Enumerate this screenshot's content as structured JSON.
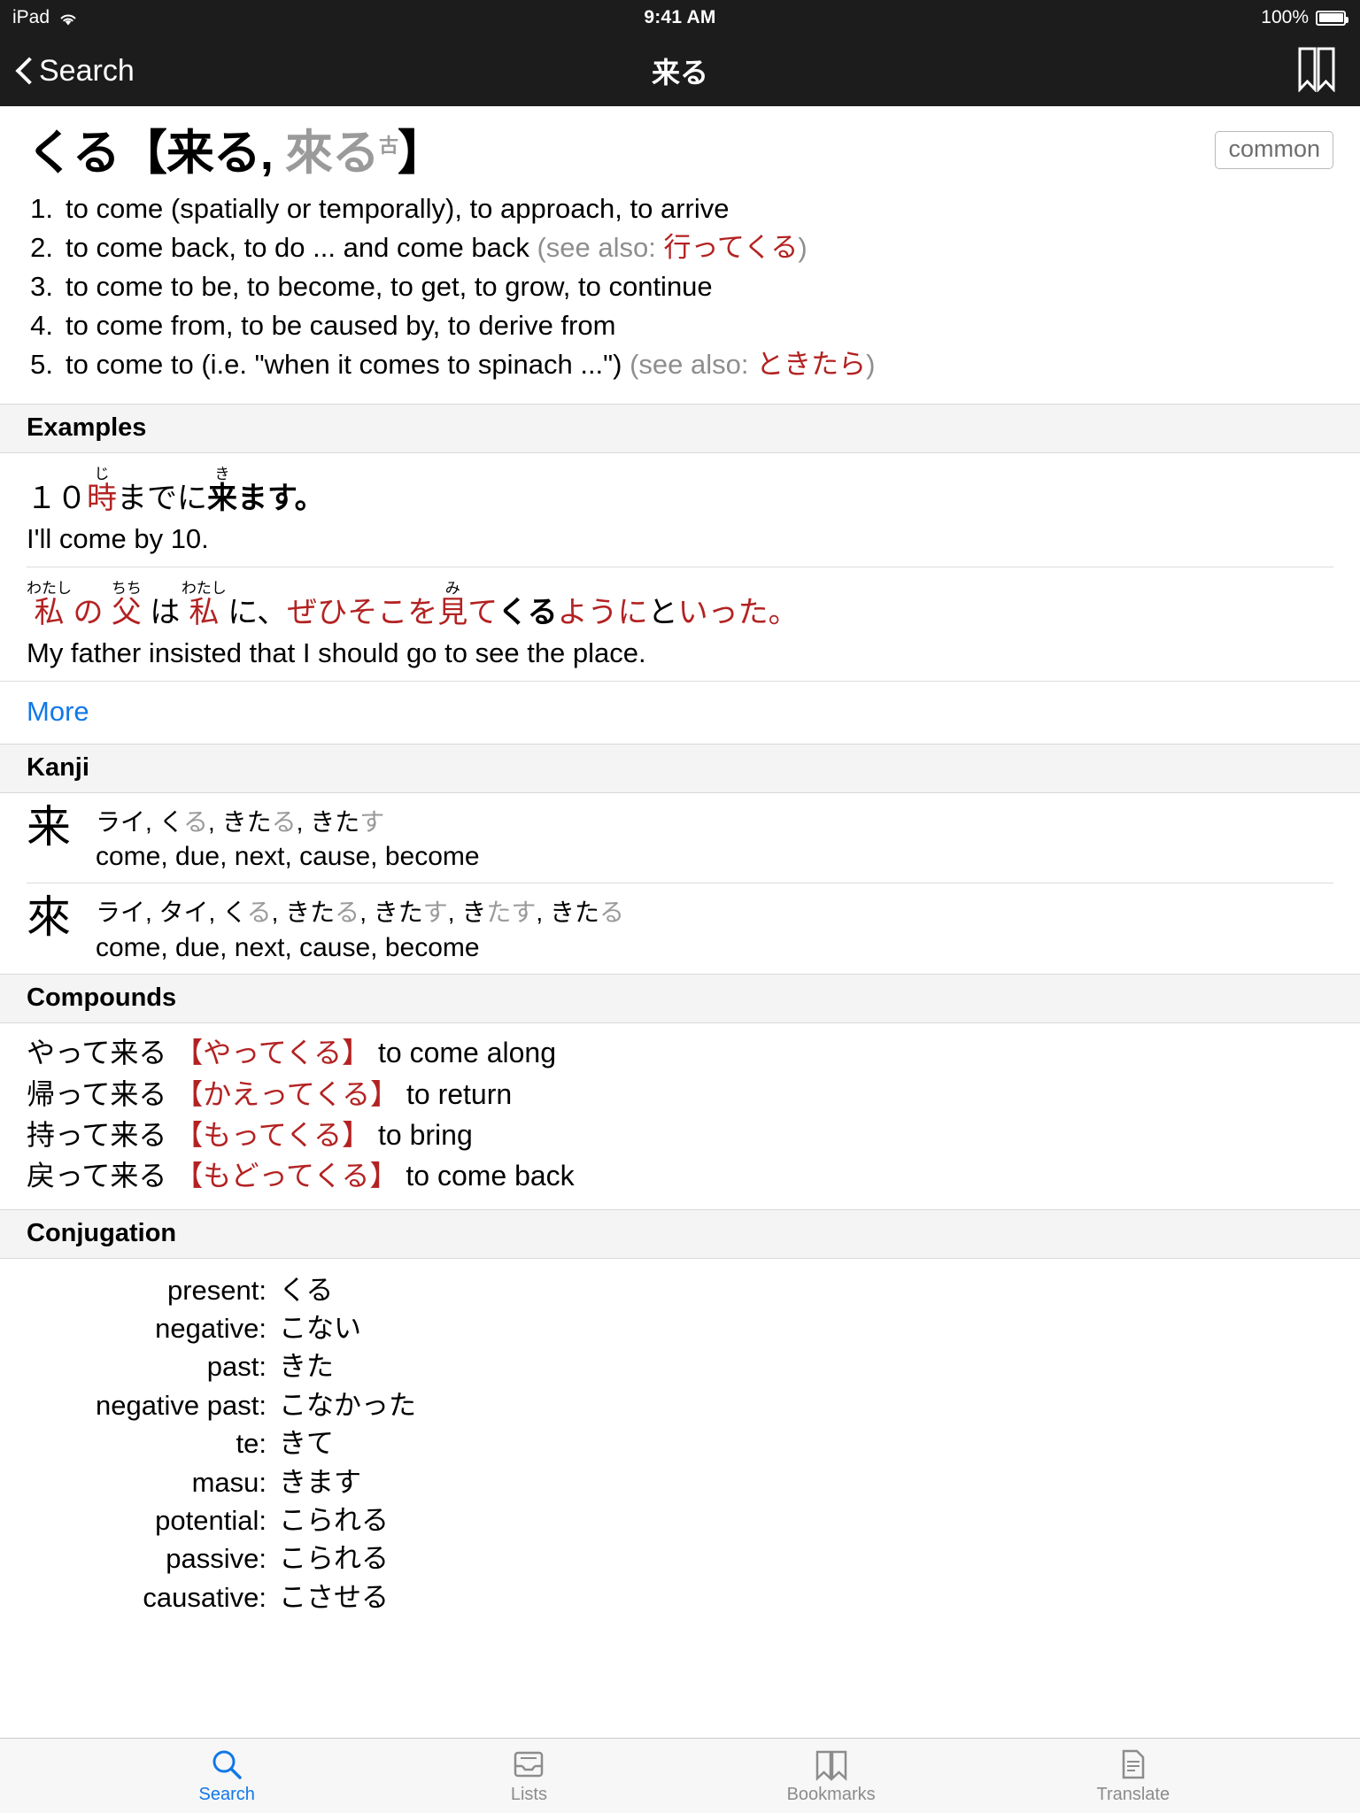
{
  "status_bar": {
    "device": "iPad",
    "wifi_icon": "wifi-icon",
    "time": "9:41 AM",
    "battery_percent": "100%",
    "battery_icon": "battery-full-icon"
  },
  "nav_bar": {
    "back_label": "Search",
    "back_icon": "chevron-left-icon",
    "title": "来る",
    "bookmark_icon": "bookmark-icon"
  },
  "entry": {
    "reading": "くる",
    "bracket_open": "【",
    "kanji_primary": "来る",
    "separator": ", ",
    "kanji_alt": "來る",
    "kanji_alt_sup": "古",
    "bracket_close": "】",
    "badge": "common",
    "senses": [
      {
        "num": "1.",
        "text": "to come (spatially or temporally), to approach, to arrive",
        "xref_label": "",
        "xref": ""
      },
      {
        "num": "2.",
        "text": "to come back, to do ... and come back ",
        "xref_label": "(see also: ",
        "xref": "行ってくる",
        "xref_close": ")"
      },
      {
        "num": "3.",
        "text": "to come to be, to become, to get, to grow, to continue",
        "xref_label": "",
        "xref": ""
      },
      {
        "num": "4.",
        "text": "to come from, to be caused by, to derive from",
        "xref_label": "",
        "xref": ""
      },
      {
        "num": "5.",
        "text": "to come to (i.e. \"when it comes to spinach ...\") ",
        "xref_label": "(see also: ",
        "xref": "ときたら",
        "xref_close": ")"
      }
    ]
  },
  "examples": {
    "header": "Examples",
    "items": [
      {
        "japanese_plain": "１０時までに来ます。",
        "english": "I'll come by 10.",
        "segments": [
          {
            "text": "１０",
            "color": "black",
            "bold": false,
            "ruby": ""
          },
          {
            "text": "時",
            "color": "red",
            "bold": false,
            "ruby": "じ"
          },
          {
            "text": "までに",
            "color": "black",
            "bold": false,
            "ruby": ""
          },
          {
            "text": "来",
            "color": "black",
            "bold": true,
            "ruby": "き"
          },
          {
            "text": "ます。",
            "color": "black",
            "bold": true,
            "ruby": ""
          }
        ]
      },
      {
        "japanese_plain": "私 の 父 は 私 に、ぜひそこを見てくるようにといった。",
        "english": "My father insisted that I should go to see the place.",
        "segments": [
          {
            "text": "私",
            "color": "red",
            "bold": false,
            "ruby": "わたし"
          },
          {
            "text": " の ",
            "color": "red",
            "bold": false,
            "ruby": ""
          },
          {
            "text": "父",
            "color": "red",
            "bold": false,
            "ruby": "ちち"
          },
          {
            "text": " は ",
            "color": "black",
            "bold": false,
            "ruby": ""
          },
          {
            "text": "私",
            "color": "red",
            "bold": false,
            "ruby": "わたし"
          },
          {
            "text": " に、",
            "color": "black",
            "bold": false,
            "ruby": ""
          },
          {
            "text": "ぜひそこを",
            "color": "red",
            "bold": false,
            "ruby": ""
          },
          {
            "text": "見",
            "color": "red",
            "bold": false,
            "ruby": "み"
          },
          {
            "text": "て",
            "color": "red",
            "bold": false,
            "ruby": ""
          },
          {
            "text": "くる",
            "color": "black",
            "bold": true,
            "ruby": ""
          },
          {
            "text": "ように",
            "color": "red",
            "bold": false,
            "ruby": ""
          },
          {
            "text": "と",
            "color": "black",
            "bold": false,
            "ruby": ""
          },
          {
            "text": "いった",
            "color": "red",
            "bold": false,
            "ruby": ""
          },
          {
            "text": "。",
            "color": "red",
            "bold": false,
            "ruby": ""
          }
        ]
      }
    ],
    "more_label": "More"
  },
  "kanji": {
    "header": "Kanji",
    "items": [
      {
        "glyph": "来",
        "readings_plain": "ライ, くる, きたる, きたす",
        "reading_parts": [
          {
            "text": "ライ, ",
            "dim": false
          },
          {
            "text": "く",
            "dim": false
          },
          {
            "text": "る",
            "dim": true
          },
          {
            "text": ", ",
            "dim": false
          },
          {
            "text": "きた",
            "dim": false
          },
          {
            "text": "る",
            "dim": true
          },
          {
            "text": ", ",
            "dim": false
          },
          {
            "text": "きた",
            "dim": false
          },
          {
            "text": "す",
            "dim": true
          }
        ],
        "meanings": "come, due, next, cause, become"
      },
      {
        "glyph": "來",
        "readings_plain": "ライ, タイ, くる, きたる, きたす, きたす, きたる",
        "reading_parts": [
          {
            "text": "ライ, タイ, ",
            "dim": false
          },
          {
            "text": "く",
            "dim": false
          },
          {
            "text": "る",
            "dim": true
          },
          {
            "text": ", ",
            "dim": false
          },
          {
            "text": "きた",
            "dim": false
          },
          {
            "text": "る",
            "dim": true
          },
          {
            "text": ", ",
            "dim": false
          },
          {
            "text": "きた",
            "dim": false
          },
          {
            "text": "す",
            "dim": true
          },
          {
            "text": ", ",
            "dim": false
          },
          {
            "text": "き",
            "dim": false
          },
          {
            "text": "たす",
            "dim": true
          },
          {
            "text": ", ",
            "dim": false
          },
          {
            "text": "きた",
            "dim": false
          },
          {
            "text": "る",
            "dim": true
          }
        ],
        "meanings": "come, due, next, cause, become"
      }
    ]
  },
  "compounds": {
    "header": "Compounds",
    "items": [
      {
        "word": "やって来る",
        "reading": "【やってくる】",
        "meaning": "to come along"
      },
      {
        "word": "帰って来る",
        "reading": "【かえってくる】",
        "meaning": "to return"
      },
      {
        "word": "持って来る",
        "reading": "【もってくる】",
        "meaning": "to bring"
      },
      {
        "word": "戻って来る",
        "reading": "【もどってくる】",
        "meaning": "to come back"
      }
    ]
  },
  "conjugation": {
    "header": "Conjugation",
    "rows": [
      {
        "label": "present:",
        "value": "くる"
      },
      {
        "label": "negative:",
        "value": "こない"
      },
      {
        "label": "past:",
        "value": "きた"
      },
      {
        "label": "negative past:",
        "value": "こなかった"
      },
      {
        "label": "te:",
        "value": "きて"
      },
      {
        "label": "masu:",
        "value": "きます"
      },
      {
        "label": "potential:",
        "value": "こられる"
      },
      {
        "label": "passive:",
        "value": "こられる"
      },
      {
        "label": "causative:",
        "value": "こさせる"
      }
    ]
  },
  "tab_bar": {
    "items": [
      {
        "label": "Search",
        "icon": "search-icon",
        "active": true
      },
      {
        "label": "Lists",
        "icon": "lists-tray-icon",
        "active": false
      },
      {
        "label": "Bookmarks",
        "icon": "bookmark-icon",
        "active": false
      },
      {
        "label": "Translate",
        "icon": "document-icon",
        "active": false
      }
    ]
  },
  "colors": {
    "accent": "#1178e8",
    "japanese_red": "#b32222",
    "navbar_bg": "#1c1c1c",
    "section_bg": "#f4f4f4"
  }
}
